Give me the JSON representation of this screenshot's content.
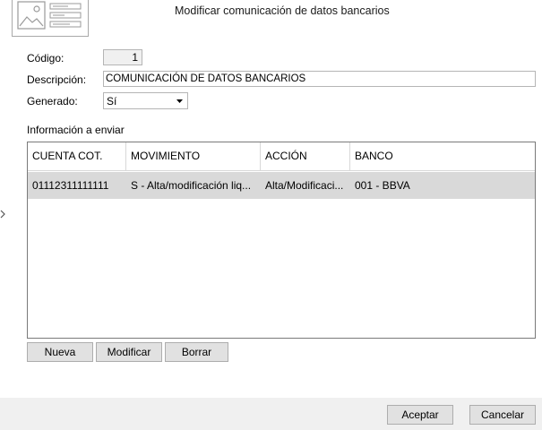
{
  "window": {
    "title": "Modificar comunicación de datos bancarios"
  },
  "form": {
    "codigo_label": "Código:",
    "codigo_value": "1",
    "descripcion_label": "Descripción:",
    "descripcion_value": "COMUNICACIÓN DE DATOS BANCARIOS",
    "generado_label": "Generado:",
    "generado_value": "Sí"
  },
  "grid": {
    "section_label": "Información a enviar",
    "columns": [
      "CUENTA COT.",
      "MOVIMIENTO",
      "ACCIÓN",
      "BANCO"
    ],
    "rows": [
      [
        "01112311111111",
        "S - Alta/modificación liq...",
        "Alta/Modificaci...",
        "001 - BBVA"
      ]
    ]
  },
  "actions": {
    "nueva": "Nueva",
    "modificar": "Modificar",
    "borrar": "Borrar"
  },
  "footer": {
    "aceptar": "Aceptar",
    "cancelar": "Cancelar"
  }
}
